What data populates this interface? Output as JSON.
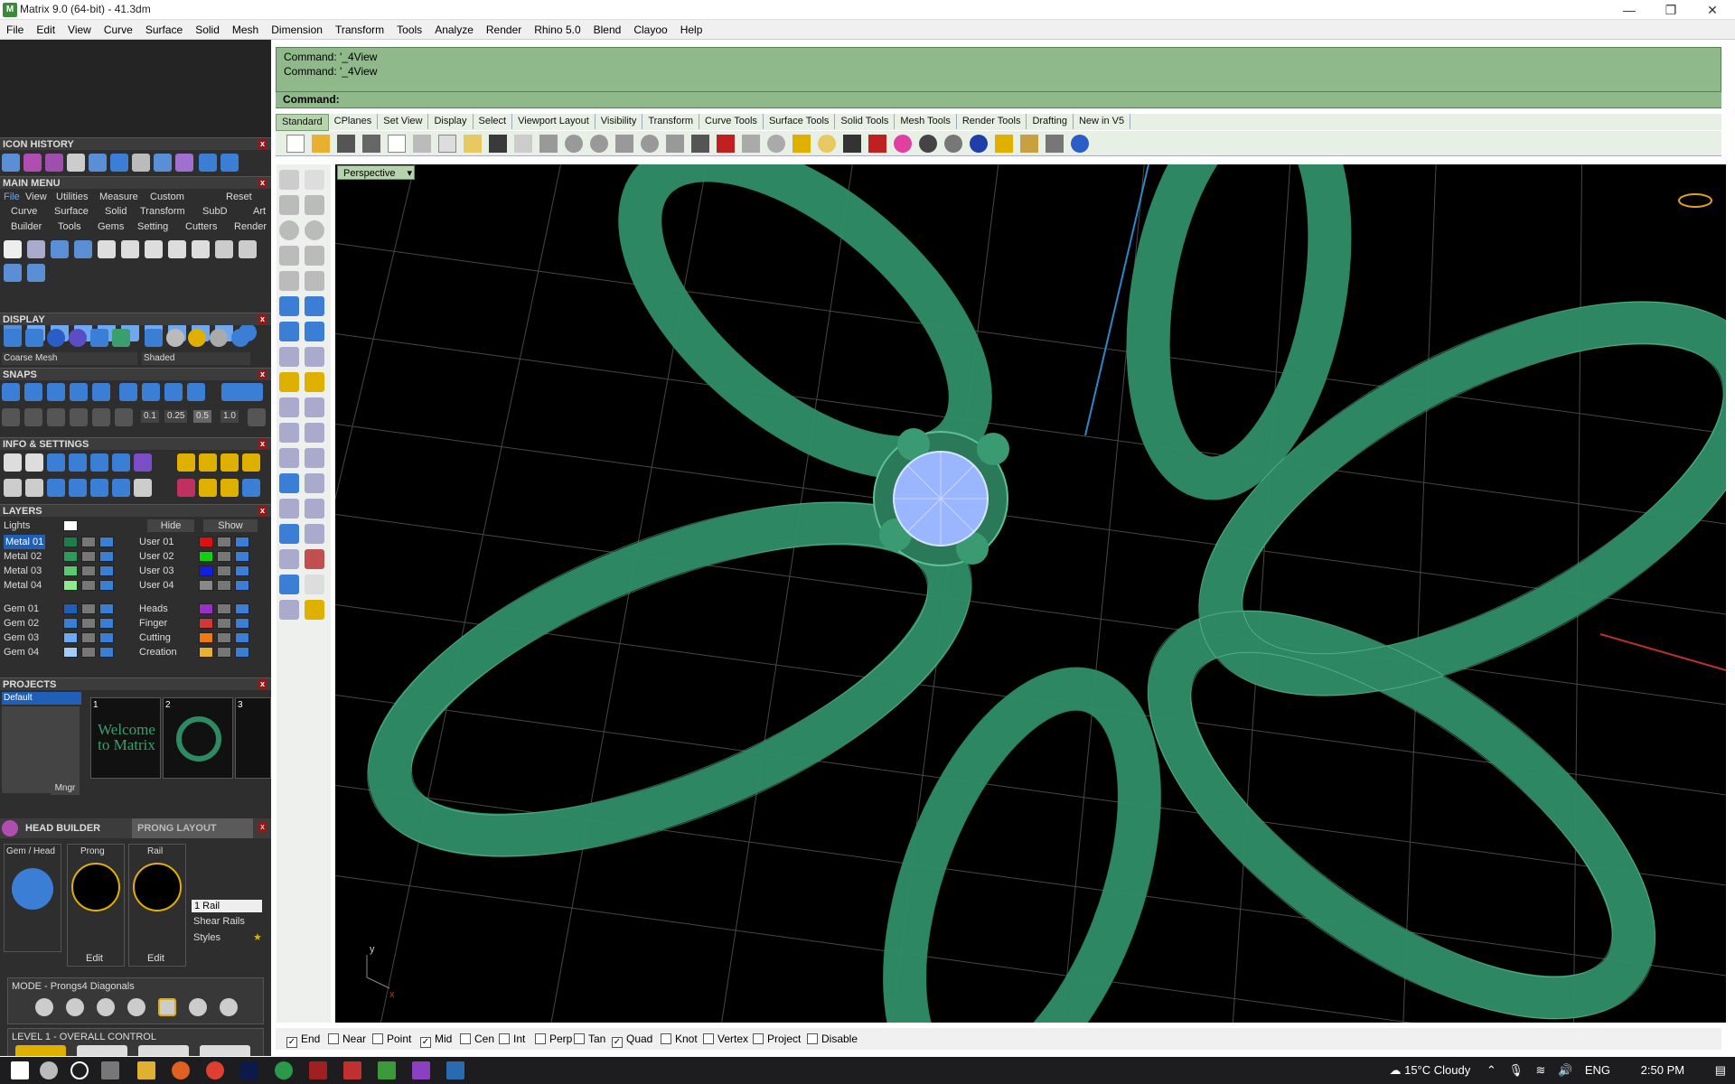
{
  "window": {
    "title": "Matrix 9.0 (64-bit) - 41.3dm"
  },
  "menu": [
    "File",
    "Edit",
    "View",
    "Curve",
    "Surface",
    "Solid",
    "Mesh",
    "Dimension",
    "Transform",
    "Tools",
    "Analyze",
    "Render",
    "Rhino 5.0",
    "Blend",
    "Clayoo",
    "Help"
  ],
  "command": {
    "history": [
      "Command: '_4View",
      "Command: '_4View"
    ],
    "label": "Command:"
  },
  "tabs": [
    "Standard",
    "CPlanes",
    "Set View",
    "Display",
    "Select",
    "Viewport Layout",
    "Visibility",
    "Transform",
    "Curve Tools",
    "Surface Tools",
    "Solid Tools",
    "Mesh Tools",
    "Render Tools",
    "Drafting",
    "New in V5"
  ],
  "left": {
    "icon_history": "ICON HISTORY",
    "main_menu": "MAIN MENU",
    "main_menu_tabs": [
      "File",
      "View",
      "Utilities",
      "Measure",
      "Custom",
      "Reset"
    ],
    "main_menu_row1": [
      "Curve",
      "Surface",
      "Solid",
      "Transform",
      "SubD",
      "Art"
    ],
    "main_menu_row2": [
      "Builder",
      "Tools",
      "Gems",
      "Setting",
      "Cutters",
      "Render"
    ],
    "display": "DISPLAY",
    "display_mesh": "Coarse Mesh",
    "display_mode": "Shaded",
    "snaps": "SNAPS",
    "snap_values": [
      "0.1",
      "0.25",
      "0.5",
      "1.0"
    ],
    "info": "INFO & SETTINGS",
    "layers": "LAYERS",
    "lights": "Lights",
    "hide": "Hide",
    "show": "Show",
    "layers_left": [
      {
        "name": "Metal 01",
        "color": "#1e7d4a"
      },
      {
        "name": "Metal 02",
        "color": "#2e9a5c"
      },
      {
        "name": "Metal 03",
        "color": "#5cc870"
      },
      {
        "name": "Metal 04",
        "color": "#8ee88e"
      },
      {
        "name": "Gem 01",
        "color": "#1f5fb8"
      },
      {
        "name": "Gem 02",
        "color": "#3b7ed6"
      },
      {
        "name": "Gem 03",
        "color": "#6ea8f0"
      },
      {
        "name": "Gem 04",
        "color": "#a5cbf7"
      }
    ],
    "layers_right": [
      {
        "name": "User 01",
        "color": "#e01010"
      },
      {
        "name": "User 02",
        "color": "#10d010"
      },
      {
        "name": "User 03",
        "color": "#1020e0"
      },
      {
        "name": "User 04",
        "color": "#888888"
      },
      {
        "name": "Heads",
        "color": "#9b30c8"
      },
      {
        "name": "Finger",
        "color": "#d03838"
      },
      {
        "name": "Cutting",
        "color": "#f07a10"
      },
      {
        "name": "Creation",
        "color": "#e8b030"
      }
    ],
    "projects": "PROJECTS",
    "project_default": "Default",
    "project_thumbs": [
      "1",
      "2",
      "3"
    ],
    "thumb_text": "Welcome to Matrix",
    "mngr": "Mngr",
    "head_builder": "HEAD  BUILDER",
    "prong_layout": "PRONG LAYOUT",
    "hb_cols": [
      "Gem / Head",
      "Prong",
      "Rail"
    ],
    "hb_edit": "Edit",
    "hb_rail": "1 Rail",
    "hb_shear": "Shear Rails",
    "hb_styles": "Styles",
    "mode": "MODE - Prongs4 Diagonals",
    "level": "LEVEL 1 - OVERALL CONTROL"
  },
  "viewport": {
    "name": "Perspective",
    "axis_y": "y",
    "axis_x": "x"
  },
  "osnap": [
    {
      "label": "End",
      "checked": true
    },
    {
      "label": "Near",
      "checked": false
    },
    {
      "label": "Point",
      "checked": false
    },
    {
      "label": "Mid",
      "checked": true
    },
    {
      "label": "Cen",
      "checked": false
    },
    {
      "label": "Int",
      "checked": false
    },
    {
      "label": "Perp",
      "checked": false
    },
    {
      "label": "Tan",
      "checked": false
    },
    {
      "label": "Quad",
      "checked": true
    },
    {
      "label": "Knot",
      "checked": false
    },
    {
      "label": "Vertex",
      "checked": false
    },
    {
      "label": "Project",
      "checked": false
    },
    {
      "label": "Disable",
      "checked": false
    }
  ],
  "taskbar": {
    "weather": "15°C  Cloudy",
    "lang": "ENG",
    "time": "2:50 PM"
  }
}
